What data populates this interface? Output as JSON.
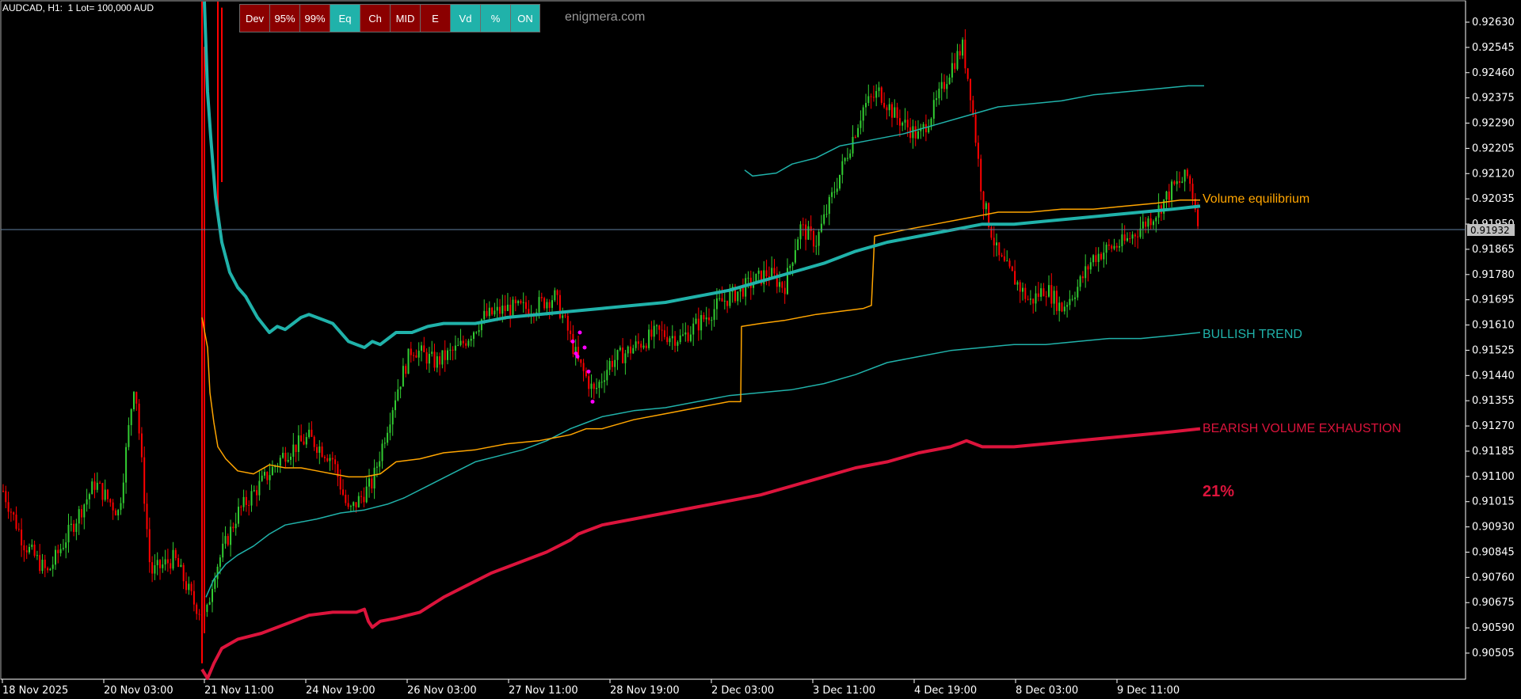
{
  "window": {
    "symbol_info": "AUDCAD, H1:  1 Lot= 100,000 AUD"
  },
  "toolbar": {
    "buttons": [
      {
        "label": "Dev",
        "state": "off"
      },
      {
        "label": "95%",
        "state": "off"
      },
      {
        "label": "99%",
        "state": "off"
      },
      {
        "label": "Eq",
        "state": "on"
      },
      {
        "label": "Ch",
        "state": "off"
      },
      {
        "label": "MID",
        "state": "off"
      },
      {
        "label": "E",
        "state": "off"
      },
      {
        "label": "Vd",
        "state": "on"
      },
      {
        "label": "%",
        "state": "on"
      },
      {
        "label": "ON",
        "state": "on"
      }
    ]
  },
  "brand": "enigmera.com",
  "labels": {
    "volume_equilibrium": "Volume equilibrium",
    "bullish_trend": "BULLISH TREND",
    "bearish_exhaustion": "BEARISH VOLUME EXHAUSTION",
    "percent": "21%"
  },
  "colors": {
    "background": "#000000",
    "bull_candle": "#32cd32",
    "bear_candle": "#ff0000",
    "equilibrium_line": "#ffa500",
    "trend_line": "#20b2aa",
    "exhaustion_line": "#dc143c",
    "button_off": "#8b0000",
    "button_on": "#20b2aa",
    "axis": "#ffffff",
    "crosshair": "#5f7f9f",
    "marker": "#ff00ff"
  },
  "chart_data": {
    "type": "candlestick",
    "y_ticks": [
      "0.92630",
      "0.92545",
      "0.92460",
      "0.92375",
      "0.92290",
      "0.92205",
      "0.92120",
      "0.92035",
      "0.91950",
      "0.91865",
      "0.91780",
      "0.91695",
      "0.91610",
      "0.91525",
      "0.91440",
      "0.91355",
      "0.91270",
      "0.91185",
      "0.91100",
      "0.91015",
      "0.90930",
      "0.90845",
      "0.90760",
      "0.90675",
      "0.90590",
      "0.90505"
    ],
    "current_price": "0.91932",
    "x_ticks": [
      "18 Nov 2025",
      "20 Nov 03:00",
      "21 Nov 11:00",
      "24 Nov 19:00",
      "26 Nov 03:00",
      "27 Nov 11:00",
      "28 Nov 19:00",
      "2 Dec 03:00",
      "3 Dec 11:00",
      "4 Dec 19:00",
      "8 Dec 03:00",
      "9 Dec 11:00"
    ],
    "ylim": [
      0.9045,
      0.927
    ],
    "series": [
      {
        "role": "price_path",
        "points": [
          [
            0,
            0.911
          ],
          [
            30,
            0.909
          ],
          [
            60,
            0.908
          ],
          [
            90,
            0.9095
          ],
          [
            120,
            0.911
          ],
          [
            150,
            0.91
          ],
          [
            170,
            0.9145
          ],
          [
            190,
            0.908
          ],
          [
            220,
            0.9085
          ],
          [
            245,
            0.907
          ],
          [
            260,
            0.9065
          ],
          [
            270,
            0.908
          ],
          [
            300,
            0.91
          ],
          [
            330,
            0.911
          ],
          [
            360,
            0.912
          ],
          [
            390,
            0.9125
          ],
          [
            420,
            0.9118
          ],
          [
            440,
            0.91
          ],
          [
            470,
            0.911
          ],
          [
            500,
            0.914
          ],
          [
            520,
            0.9155
          ],
          [
            550,
            0.915
          ],
          [
            580,
            0.9155
          ],
          [
            610,
            0.9165
          ],
          [
            640,
            0.9168
          ],
          [
            670,
            0.9168
          ],
          [
            700,
            0.9172
          ],
          [
            715,
            0.9162
          ],
          [
            730,
            0.915
          ],
          [
            750,
            0.914
          ],
          [
            770,
            0.915
          ],
          [
            800,
            0.9155
          ],
          [
            830,
            0.916
          ],
          [
            860,
            0.9158
          ],
          [
            890,
            0.9165
          ],
          [
            910,
            0.917
          ],
          [
            940,
            0.9175
          ],
          [
            970,
            0.918
          ],
          [
            990,
            0.9175
          ],
          [
            1010,
            0.9195
          ],
          [
            1030,
            0.919
          ],
          [
            1050,
            0.9205
          ],
          [
            1070,
            0.922
          ],
          [
            1090,
            0.9235
          ],
          [
            1110,
            0.924
          ],
          [
            1130,
            0.9232
          ],
          [
            1160,
            0.9225
          ],
          [
            1180,
            0.9235
          ],
          [
            1200,
            0.9248
          ],
          [
            1215,
            0.9255
          ],
          [
            1225,
            0.924
          ],
          [
            1240,
            0.9205
          ],
          [
            1260,
            0.9185
          ],
          [
            1280,
            0.9178
          ],
          [
            1300,
            0.917
          ],
          [
            1320,
            0.9175
          ],
          [
            1340,
            0.9168
          ],
          [
            1360,
            0.9175
          ],
          [
            1380,
            0.9185
          ],
          [
            1400,
            0.9188
          ],
          [
            1420,
            0.919
          ],
          [
            1440,
            0.9195
          ],
          [
            1460,
            0.92
          ],
          [
            1480,
            0.9208
          ],
          [
            1500,
            0.9212
          ],
          [
            1515,
            0.9195
          ]
        ]
      },
      {
        "role": "volume_equilibrium",
        "points": [
          [
            255,
            0.9165
          ],
          [
            262,
            0.9155
          ],
          [
            265,
            0.914
          ],
          [
            270,
            0.913
          ],
          [
            275,
            0.9122
          ],
          [
            285,
            0.9118
          ],
          [
            300,
            0.9114
          ],
          [
            320,
            0.9113
          ],
          [
            340,
            0.9116
          ],
          [
            360,
            0.9115
          ],
          [
            380,
            0.9115
          ],
          [
            400,
            0.9114
          ],
          [
            420,
            0.9113
          ],
          [
            440,
            0.9112
          ],
          [
            460,
            0.9112
          ],
          [
            480,
            0.9113
          ],
          [
            500,
            0.9117
          ],
          [
            530,
            0.9118
          ],
          [
            560,
            0.912
          ],
          [
            600,
            0.9121
          ],
          [
            640,
            0.9123
          ],
          [
            680,
            0.9124
          ],
          [
            700,
            0.9125
          ],
          [
            720,
            0.9126
          ],
          [
            740,
            0.9128
          ],
          [
            760,
            0.9128
          ],
          [
            800,
            0.9131
          ],
          [
            840,
            0.9133
          ],
          [
            880,
            0.9135
          ],
          [
            920,
            0.9137
          ],
          [
            935,
            0.9137
          ],
          [
            936,
            0.9162
          ],
          [
            960,
            0.9163
          ],
          [
            990,
            0.9164
          ],
          [
            1030,
            0.9166
          ],
          [
            1060,
            0.9167
          ],
          [
            1090,
            0.9168
          ],
          [
            1100,
            0.9169
          ],
          [
            1104,
            0.9192
          ],
          [
            1140,
            0.9194
          ],
          [
            1180,
            0.9196
          ],
          [
            1220,
            0.9198
          ],
          [
            1240,
            0.9199
          ],
          [
            1260,
            0.92
          ],
          [
            1300,
            0.92
          ],
          [
            1340,
            0.9201
          ],
          [
            1380,
            0.9201
          ],
          [
            1420,
            0.9202
          ],
          [
            1460,
            0.9203
          ],
          [
            1490,
            0.9204
          ],
          [
            1515,
            0.9204
          ]
        ]
      },
      {
        "role": "trend_thick",
        "points": [
          [
            258,
            0.927
          ],
          [
            262,
            0.924
          ],
          [
            266,
            0.9225
          ],
          [
            272,
            0.9205
          ],
          [
            280,
            0.919
          ],
          [
            290,
            0.918
          ],
          [
            300,
            0.9175
          ],
          [
            310,
            0.9172
          ],
          [
            325,
            0.9165
          ],
          [
            340,
            0.916
          ],
          [
            350,
            0.9162
          ],
          [
            360,
            0.9161
          ],
          [
            370,
            0.9163
          ],
          [
            380,
            0.9165
          ],
          [
            390,
            0.9166
          ],
          [
            400,
            0.9165
          ],
          [
            410,
            0.9164
          ],
          [
            420,
            0.9163
          ],
          [
            430,
            0.916
          ],
          [
            440,
            0.9157
          ],
          [
            450,
            0.9156
          ],
          [
            460,
            0.9155
          ],
          [
            470,
            0.9157
          ],
          [
            480,
            0.9156
          ],
          [
            490,
            0.9158
          ],
          [
            500,
            0.916
          ],
          [
            520,
            0.916
          ],
          [
            540,
            0.9162
          ],
          [
            560,
            0.9163
          ],
          [
            600,
            0.9163
          ],
          [
            640,
            0.9165
          ],
          [
            680,
            0.9166
          ],
          [
            720,
            0.9167
          ],
          [
            760,
            0.9168
          ],
          [
            800,
            0.9169
          ],
          [
            840,
            0.917
          ],
          [
            880,
            0.9172
          ],
          [
            920,
            0.9174
          ],
          [
            960,
            0.9177
          ],
          [
            1000,
            0.918
          ],
          [
            1040,
            0.9183
          ],
          [
            1080,
            0.9187
          ],
          [
            1120,
            0.919
          ],
          [
            1160,
            0.9192
          ],
          [
            1200,
            0.9194
          ],
          [
            1240,
            0.9196
          ],
          [
            1280,
            0.9196
          ],
          [
            1320,
            0.9197
          ],
          [
            1360,
            0.9198
          ],
          [
            1400,
            0.9199
          ],
          [
            1440,
            0.92
          ],
          [
            1480,
            0.9201
          ],
          [
            1515,
            0.9202
          ]
        ]
      },
      {
        "role": "trend_thin",
        "points": [
          [
            260,
            0.9072
          ],
          [
            270,
            0.9078
          ],
          [
            285,
            0.9083
          ],
          [
            300,
            0.9086
          ],
          [
            320,
            0.9089
          ],
          [
            340,
            0.9093
          ],
          [
            360,
            0.9096
          ],
          [
            380,
            0.9097
          ],
          [
            400,
            0.9098
          ],
          [
            430,
            0.91
          ],
          [
            460,
            0.9101
          ],
          [
            490,
            0.9103
          ],
          [
            510,
            0.9105
          ],
          [
            540,
            0.9109
          ],
          [
            570,
            0.9113
          ],
          [
            600,
            0.9117
          ],
          [
            630,
            0.9119
          ],
          [
            660,
            0.9121
          ],
          [
            690,
            0.9124
          ],
          [
            720,
            0.9128
          ],
          [
            740,
            0.913
          ],
          [
            760,
            0.9132
          ],
          [
            780,
            0.9133
          ],
          [
            800,
            0.9134
          ],
          [
            840,
            0.9135
          ],
          [
            880,
            0.9137
          ],
          [
            920,
            0.9139
          ],
          [
            960,
            0.914
          ],
          [
            1000,
            0.9141
          ],
          [
            1040,
            0.9143
          ],
          [
            1080,
            0.9146
          ],
          [
            1120,
            0.915
          ],
          [
            1160,
            0.9152
          ],
          [
            1200,
            0.9154
          ],
          [
            1240,
            0.9155
          ],
          [
            1280,
            0.9156
          ],
          [
            1320,
            0.9156
          ],
          [
            1360,
            0.9157
          ],
          [
            1400,
            0.9158
          ],
          [
            1440,
            0.9158
          ],
          [
            1480,
            0.9159
          ],
          [
            1515,
            0.916
          ]
        ]
      },
      {
        "role": "trend_upper",
        "points": [
          [
            940,
            0.9214
          ],
          [
            950,
            0.9212
          ],
          [
            980,
            0.9213
          ],
          [
            1000,
            0.9216
          ],
          [
            1030,
            0.9218
          ],
          [
            1060,
            0.9222
          ],
          [
            1100,
            0.9224
          ],
          [
            1140,
            0.9226
          ],
          [
            1180,
            0.9229
          ],
          [
            1220,
            0.9232
          ],
          [
            1260,
            0.9235
          ],
          [
            1300,
            0.9236
          ],
          [
            1340,
            0.9237
          ],
          [
            1380,
            0.9239
          ],
          [
            1420,
            0.924
          ],
          [
            1460,
            0.9241
          ],
          [
            1500,
            0.9242
          ],
          [
            1520,
            0.9242
          ]
        ]
      },
      {
        "role": "exhaustion",
        "points": [
          [
            255,
            0.9048
          ],
          [
            262,
            0.9045
          ],
          [
            270,
            0.905
          ],
          [
            280,
            0.9055
          ],
          [
            300,
            0.9058
          ],
          [
            330,
            0.906
          ],
          [
            360,
            0.9063
          ],
          [
            390,
            0.9066
          ],
          [
            420,
            0.9067
          ],
          [
            450,
            0.9067
          ],
          [
            460,
            0.9068
          ],
          [
            465,
            0.9064
          ],
          [
            470,
            0.9062
          ],
          [
            480,
            0.9064
          ],
          [
            500,
            0.9065
          ],
          [
            530,
            0.9067
          ],
          [
            560,
            0.9072
          ],
          [
            590,
            0.9076
          ],
          [
            620,
            0.908
          ],
          [
            650,
            0.9083
          ],
          [
            690,
            0.9087
          ],
          [
            720,
            0.9091
          ],
          [
            730,
            0.9093
          ],
          [
            740,
            0.9094
          ],
          [
            760,
            0.9096
          ],
          [
            800,
            0.9098
          ],
          [
            840,
            0.91
          ],
          [
            880,
            0.9102
          ],
          [
            920,
            0.9104
          ],
          [
            960,
            0.9106
          ],
          [
            1000,
            0.9109
          ],
          [
            1040,
            0.9112
          ],
          [
            1080,
            0.9115
          ],
          [
            1120,
            0.9117
          ],
          [
            1160,
            0.912
          ],
          [
            1200,
            0.9122
          ],
          [
            1220,
            0.9124
          ],
          [
            1240,
            0.9122
          ],
          [
            1280,
            0.9122
          ],
          [
            1320,
            0.9123
          ],
          [
            1360,
            0.9124
          ],
          [
            1400,
            0.9125
          ],
          [
            1440,
            0.9126
          ],
          [
            1480,
            0.9127
          ],
          [
            1515,
            0.9128
          ]
        ]
      }
    ]
  }
}
